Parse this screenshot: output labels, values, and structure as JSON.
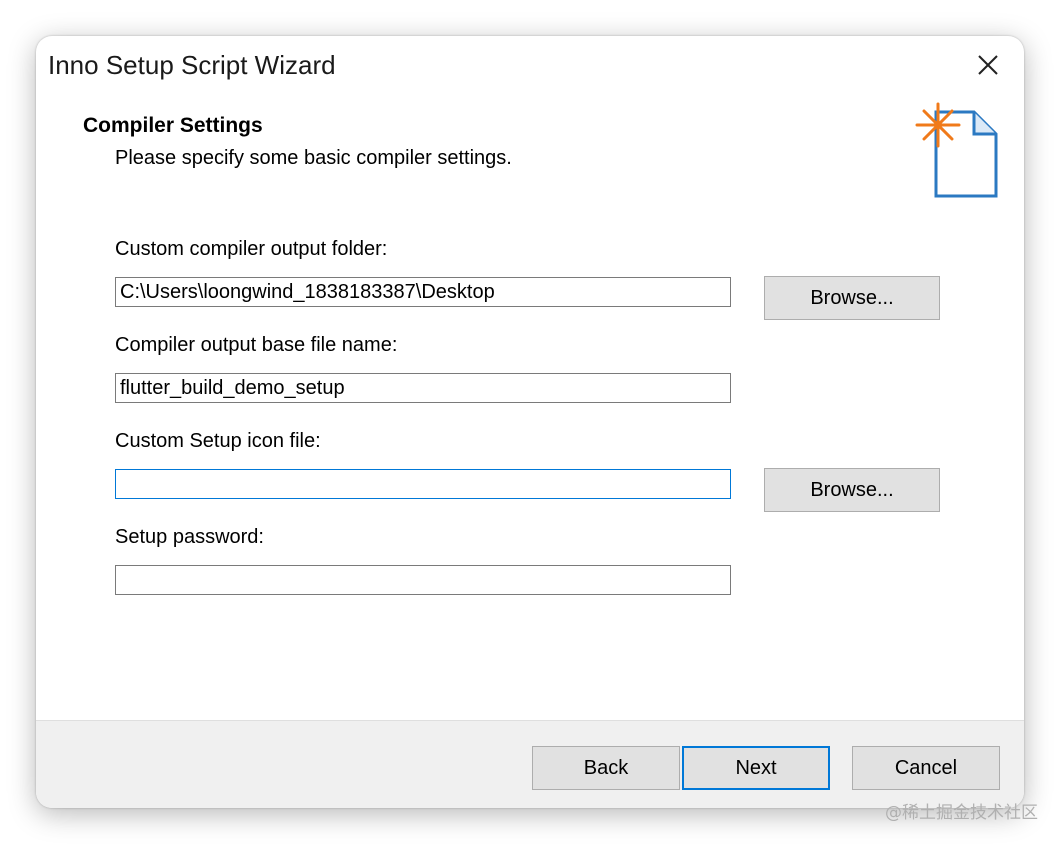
{
  "window": {
    "title": "Inno Setup Script Wizard",
    "close_icon": "close-icon"
  },
  "page": {
    "heading": "Compiler Settings",
    "subheading": "Please specify some basic compiler settings.",
    "icon": "wizard-document-sparkle-icon"
  },
  "fields": {
    "output_folder": {
      "label": "Custom compiler output folder:",
      "value": "C:\\Users\\loongwind_1838183387\\Desktop",
      "browse_label": "Browse..."
    },
    "base_filename": {
      "label": "Compiler output base file name:",
      "value": "flutter_build_demo_setup"
    },
    "setup_icon": {
      "label": "Custom Setup icon file:",
      "value": "",
      "browse_label": "Browse..."
    },
    "password": {
      "label": "Setup password:",
      "value": ""
    }
  },
  "footer": {
    "back_label": "Back",
    "next_label": "Next",
    "cancel_label": "Cancel"
  },
  "watermark": "@稀土掘金技术社区",
  "colors": {
    "accent": "#0078d7",
    "footer_bg": "#f0f0f0",
    "button_bg": "#e1e1e1",
    "sparkle": "#f07a1a"
  }
}
